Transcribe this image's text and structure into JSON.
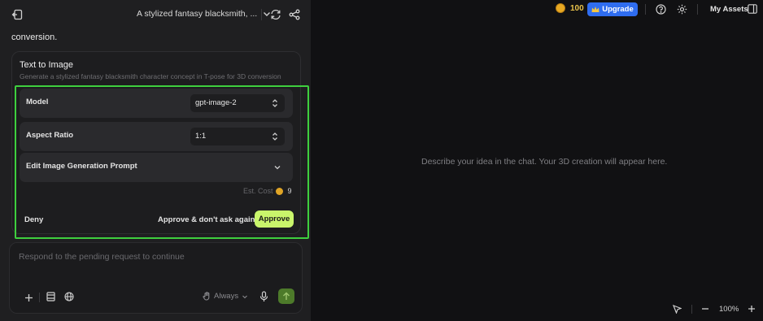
{
  "header": {
    "conversation_title": "A stylized fantasy blacksmith, ..."
  },
  "chat": {
    "previous_text": "conversion.",
    "tool_card": {
      "title": "Text to Image",
      "subtitle": "Generate a stylized fantasy blacksmith character concept in T-pose for 3D conversion",
      "model_label": "Model",
      "model_value": "gpt-image-2",
      "aspect_label": "Aspect Ratio",
      "aspect_value": "1:1",
      "prompt_label": "Edit Image Generation Prompt",
      "cost_label": "Est. Cost",
      "cost_value": "9",
      "deny_label": "Deny",
      "approve_always_label": "Approve & don't ask again",
      "approve_label": "Approve"
    },
    "input": {
      "placeholder": "Respond to the pending request to continue",
      "mode_label": "Always"
    }
  },
  "topbar_right": {
    "credits": "100",
    "upgrade_label": "Upgrade",
    "assets_label": "My Assets"
  },
  "canvas": {
    "empty_message": "Describe your idea in the chat. Your 3D creation will appear here.",
    "zoom": "100%"
  },
  "colors": {
    "accent_approve": "#c9f56b",
    "upgrade_blue": "#2f6df0",
    "highlight_green": "#3ecf3e",
    "coin": "#e8a923"
  }
}
